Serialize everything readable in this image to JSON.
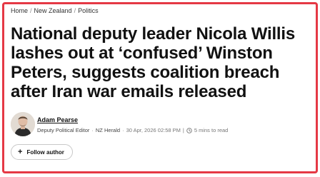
{
  "breadcrumb": {
    "items": [
      "Home",
      "New Zealand",
      "Politics"
    ],
    "separator": "/"
  },
  "article": {
    "headline": "National deputy leader Nicola Willis lashes out at ‘confused’ Winston Peters, suggests coalition breach after Iran war emails released"
  },
  "author": {
    "name": "Adam Pearse",
    "role": "Deputy Political Editor",
    "publication": "NZ Herald",
    "date": "30 Apr, 2026 02:58 PM",
    "read_time": "5 mins to read",
    "follow_label": "Follow author"
  },
  "colors": {
    "frame_border": "#e53945",
    "text": "#111111",
    "muted": "#777777"
  },
  "icons": {
    "clock": "clock-icon",
    "plus": "plus-icon"
  }
}
